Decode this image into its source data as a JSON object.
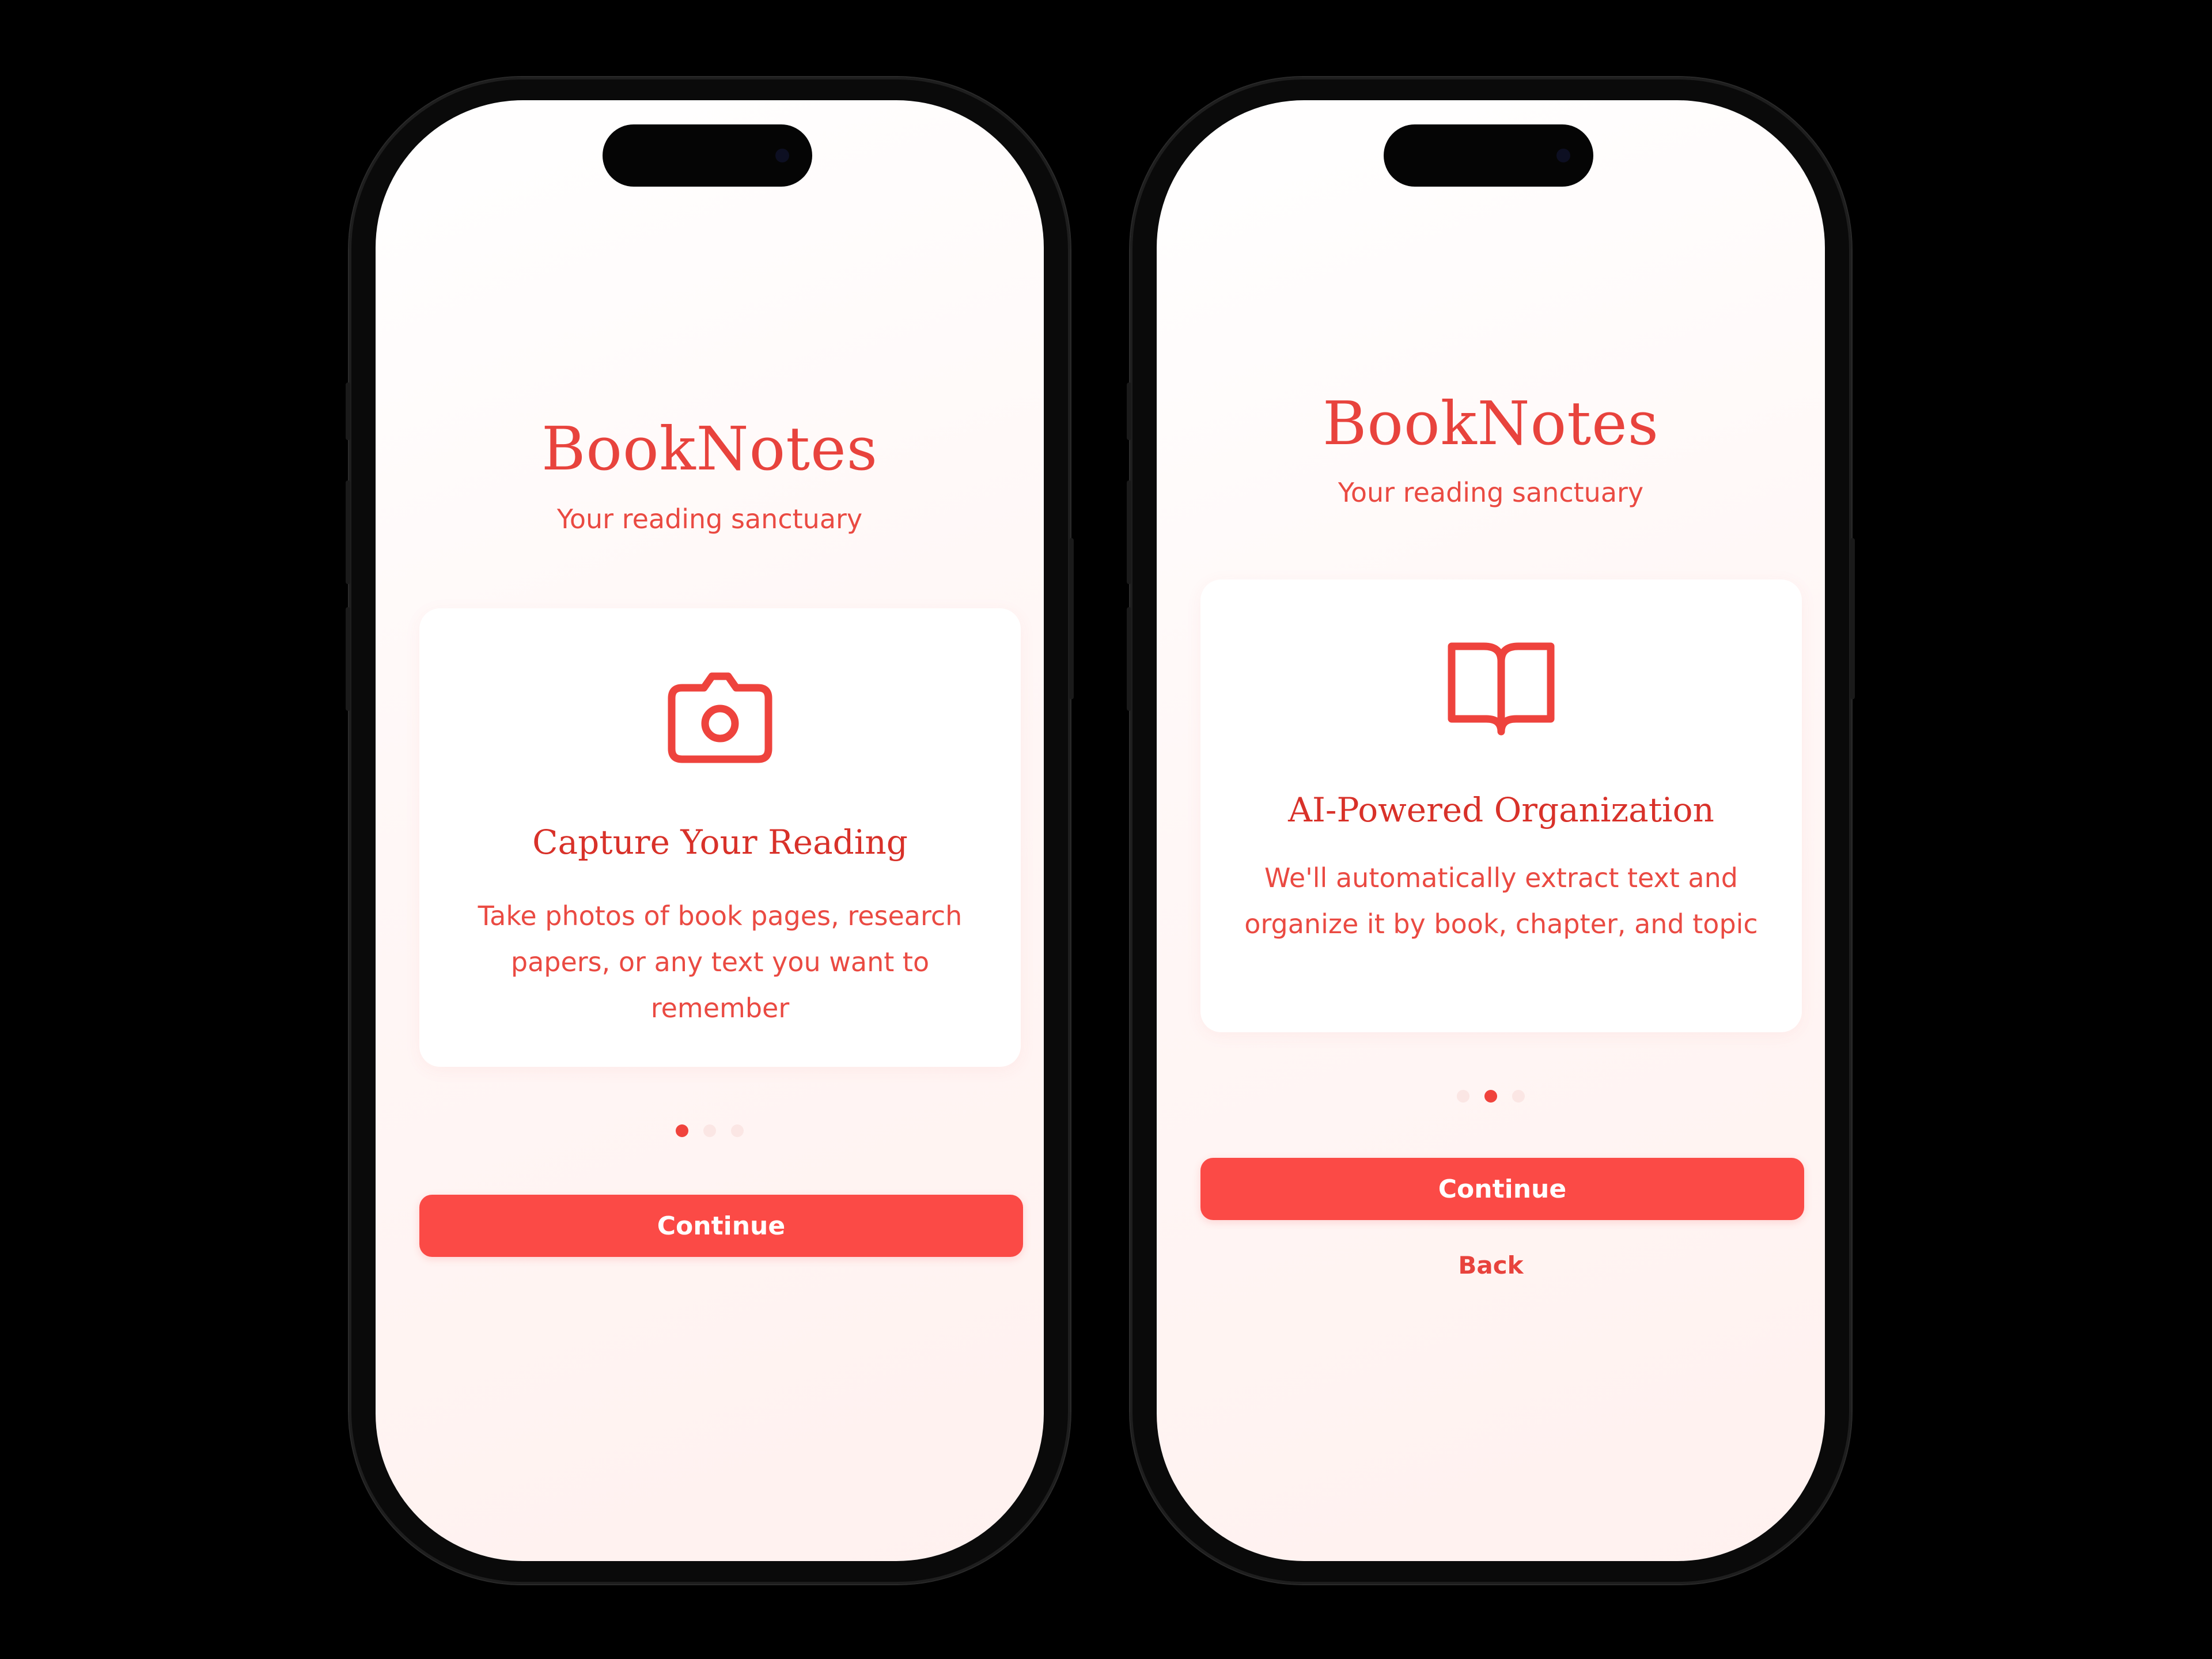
{
  "brand": {
    "accent": "#e8433d",
    "button": "#fb4a46"
  },
  "screens": [
    {
      "title": "BookNotes",
      "subtitle": "Your reading sanctuary",
      "card": {
        "icon": "camera-icon",
        "heading": "Capture Your Reading",
        "description": "Take photos of book pages, research papers, or any text you want to remember"
      },
      "pagination": {
        "total": 3,
        "active": 1
      },
      "primary_button": "Continue"
    },
    {
      "title": "BookNotes",
      "subtitle": "Your reading sanctuary",
      "card": {
        "icon": "book-open-icon",
        "heading": "AI-Powered Organization",
        "description": "We'll automatically extract text and organize it by book, chapter, and topic"
      },
      "pagination": {
        "total": 3,
        "active": 2
      },
      "primary_button": "Continue",
      "secondary_button": "Back"
    }
  ]
}
